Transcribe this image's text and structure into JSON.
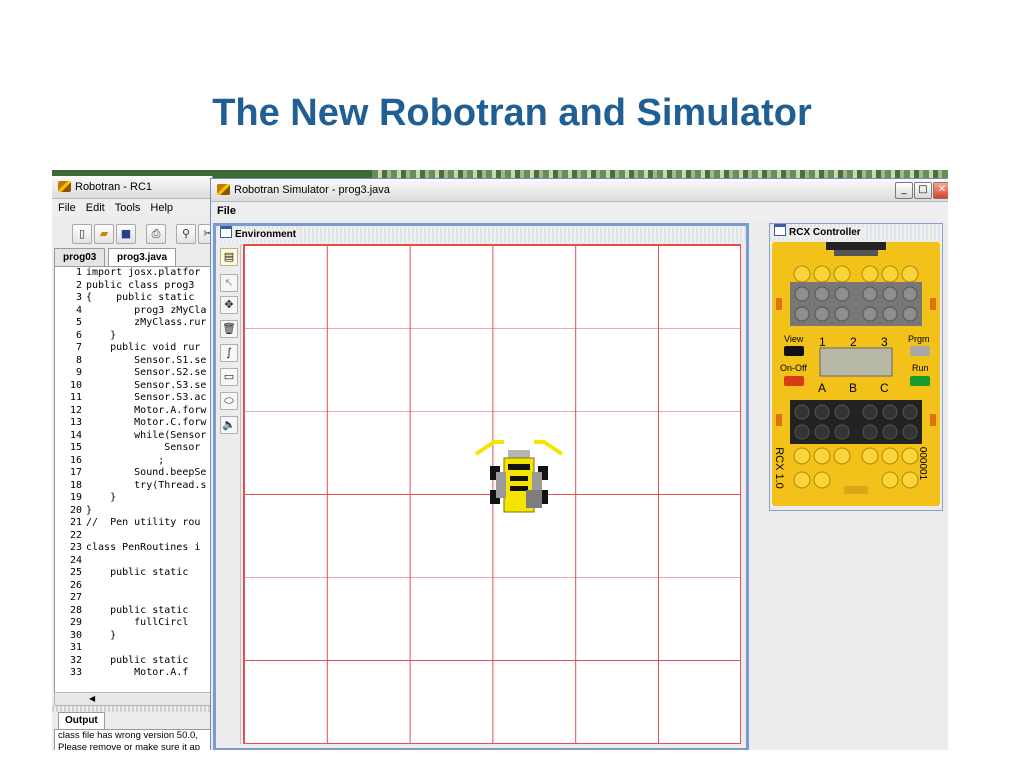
{
  "slide": {
    "title": "The New Robotran and Simulator"
  },
  "editor": {
    "title": "Robotran - RC1",
    "menu": [
      "File",
      "Edit",
      "Tools",
      "Help"
    ],
    "tabs": [
      "prog03",
      "prog3.java"
    ],
    "code_lines": [
      "import josx.platfor",
      "public class prog3 ",
      "{    public static ",
      "        prog3 zMyCla",
      "        zMyClass.rur",
      "    }",
      "    public void rur",
      "        Sensor.S1.se",
      "        Sensor.S2.se",
      "        Sensor.S3.se",
      "        Sensor.S3.ac",
      "        Motor.A.forw",
      "        Motor.C.forw",
      "        while(Sensor",
      "             Sensor",
      "            ;",
      "        Sound.beepSe",
      "        try(Thread.s",
      "    }",
      "}",
      "//  Pen utility rou",
      "",
      "class PenRoutines i",
      "",
      "    public static ",
      "",
      "",
      "    public static ",
      "        fullCircl",
      "    }",
      "",
      "    public static ",
      "        Motor.A.f"
    ],
    "output_tab": "Output",
    "output_lines": [
      "class file has wrong version 50.0,",
      "Please remove or make sure it ap"
    ]
  },
  "simulator": {
    "title": "Robotran Simulator - prog3.java",
    "menu": [
      "File"
    ],
    "environment_title": "Environment",
    "rcx_title": "RCX Controller"
  },
  "rcx": {
    "buttons": {
      "view": "View",
      "prgm": "Prgm",
      "onoff": "On-Off",
      "run": "Run"
    },
    "sensor_ports": [
      "1",
      "2",
      "3"
    ],
    "motor_ports": [
      "A",
      "B",
      "C"
    ],
    "model": "RCX 1.0",
    "serial": "000001"
  },
  "colors": {
    "title_blue": "#1f5f93",
    "grid_red": "#e05050",
    "lego_yellow": "#f3c21a",
    "robot_yellow": "#f4e400",
    "window_border": "#6d8fbf"
  }
}
